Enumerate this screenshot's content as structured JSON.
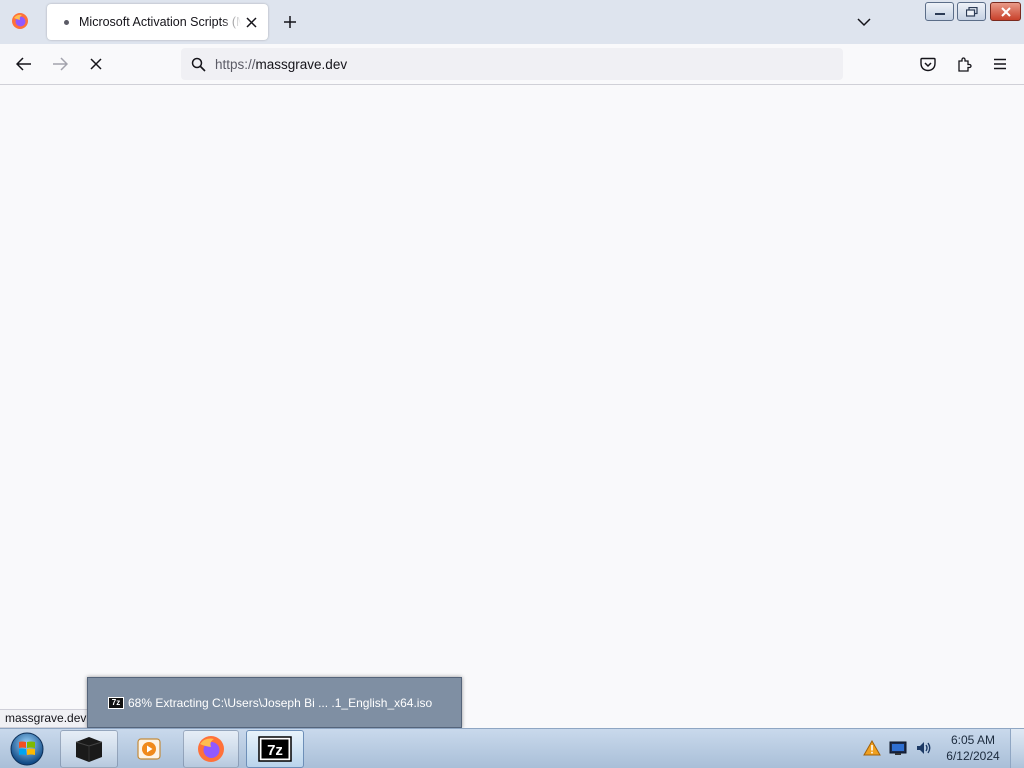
{
  "browser": {
    "tab": {
      "title": "Microsoft Activation Scripts (MAS)"
    },
    "urlbar": {
      "scheme": "https://",
      "host": "massgrave.dev"
    },
    "status": {
      "text": "massgrave.dev"
    }
  },
  "taskbar": {
    "thumbnail": {
      "icon_label": "7z",
      "text": "68% Extracting C:\\Users\\Joseph Bi ... .1_English_x64.iso"
    },
    "apps": [
      {
        "name": "terminal",
        "icon": "black-box-icon"
      },
      {
        "name": "media-player",
        "icon": "play-icon"
      },
      {
        "name": "firefox",
        "icon": "firefox-icon"
      },
      {
        "name": "7-zip",
        "icon": "7z-icon",
        "label": "7z"
      }
    ],
    "clock": {
      "time": "6:05 AM",
      "date": "6/12/2024"
    }
  },
  "colors": {
    "tab_strip": "#dee4ee",
    "page_bg": "#f9f9fb",
    "taskbar": "#b9cce3",
    "thumbnail_bg": "#7f8fa3"
  }
}
